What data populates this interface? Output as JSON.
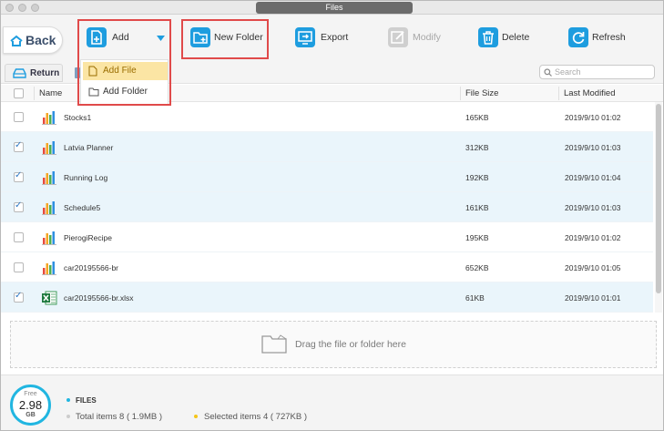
{
  "window": {
    "title": "Files"
  },
  "toolbar": {
    "back_label": "Back",
    "add_label": "Add",
    "new_folder_label": "New Folder",
    "export_label": "Export",
    "modify_label": "Modify",
    "delete_label": "Delete",
    "refresh_label": "Refresh"
  },
  "add_menu": {
    "items": [
      {
        "label": "Add File",
        "active": true
      },
      {
        "label": "Add Folder",
        "active": false
      }
    ]
  },
  "subbar": {
    "return_label": "Return",
    "search_placeholder": "Search"
  },
  "table": {
    "columns": {
      "name": "Name",
      "size": "File Size",
      "modified": "Last Modified"
    },
    "rows": [
      {
        "name": "Stocks1",
        "size": "165KB",
        "date": "2019/9/10  01:02",
        "checked": false,
        "icon": "numbers-chart-icon"
      },
      {
        "name": "Latvia Planner",
        "size": "312KB",
        "date": "2019/9/10  01:03",
        "checked": true,
        "icon": "numbers-chart-icon"
      },
      {
        "name": "Running Log",
        "size": "192KB",
        "date": "2019/9/10  01:04",
        "checked": true,
        "icon": "numbers-chart-icon"
      },
      {
        "name": "Schedule5",
        "size": "161KB",
        "date": "2019/9/10  01:03",
        "checked": true,
        "icon": "numbers-chart-icon"
      },
      {
        "name": "PierogiRecipe",
        "size": "195KB",
        "date": "2019/9/10  01:02",
        "checked": false,
        "icon": "numbers-chart-icon"
      },
      {
        "name": "car20195566-br",
        "size": "652KB",
        "date": "2019/9/10  01:05",
        "checked": false,
        "icon": "numbers-chart-icon"
      },
      {
        "name": "car20195566-br.xlsx",
        "size": "61KB",
        "date": "2019/9/10  01:01",
        "checked": true,
        "icon": "excel-icon"
      }
    ]
  },
  "dropzone": {
    "label": "Drag the file or folder here"
  },
  "footer": {
    "free_label": "Free",
    "free_value": "2.98",
    "free_unit": "GB",
    "section_title": "FILES",
    "total_items": "Total items 8 ( 1.9MB )",
    "selected_items": "Selected items 4 ( 727KB )"
  },
  "colors": {
    "accent": "#1e9ddf",
    "highlight_box": "#e04a4a",
    "selected_row": "#eaf5fb",
    "menu_active": "#fbe5a4",
    "files_dot": "#21b6e1",
    "total_dot": "#cccccc",
    "selected_dot": "#f5c518"
  }
}
